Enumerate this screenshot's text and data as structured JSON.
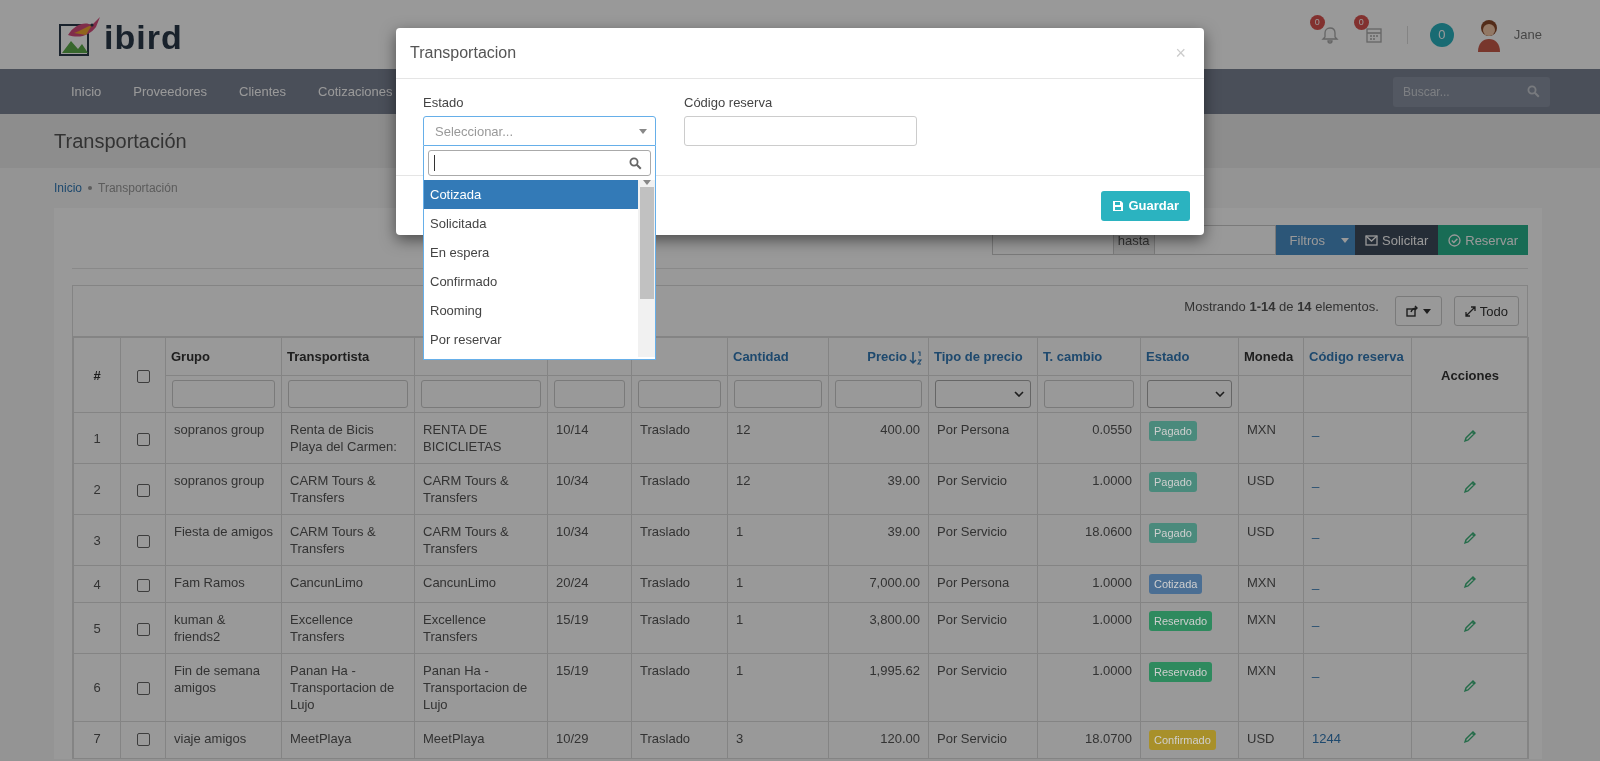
{
  "header": {
    "logo": "ibird",
    "notifications": [
      {
        "kind": "bell",
        "count": "0"
      },
      {
        "kind": "calendar",
        "count": "0"
      }
    ],
    "messages": "0",
    "user": "Jane"
  },
  "nav": {
    "items": [
      "Inicio",
      "Proveedores",
      "Clientes",
      "Cotizaciones"
    ],
    "search": {
      "placeholder": "Buscar..."
    }
  },
  "page_title": "Transportación",
  "breadcrumb": [
    "Inicio",
    "Transportación"
  ],
  "toolbar": {
    "range_separator": "hasta",
    "buttons": [
      {
        "kind": "filter",
        "label": "Filtros"
      },
      {
        "kind": "request",
        "label": "Solicitar"
      },
      {
        "kind": "reserve",
        "label": "Reservar"
      }
    ]
  },
  "table": {
    "summary": "Mostrando **1-14** de **14** elementos.",
    "expand_button": "Todo",
    "columns": [
      {
        "kind": "index",
        "label": "#"
      },
      {
        "kind": "checkbox",
        "checked": false
      },
      {
        "kind": "data",
        "label": "Grupo",
        "sortable": false,
        "filter": {
          "kind": "text"
        }
      },
      {
        "kind": "data",
        "label": "Transportista",
        "sortable": false,
        "filter": {
          "kind": "text"
        }
      },
      {
        "kind": "data",
        "filter": {
          "kind": "text"
        }
      },
      {
        "kind": "data",
        "filter": {
          "kind": "text"
        }
      },
      {
        "kind": "data",
        "filter": {
          "kind": "text"
        }
      },
      {
        "kind": "data",
        "label": "Cantidad",
        "sortable": true,
        "sorted": false,
        "filter": {
          "kind": "text"
        }
      },
      {
        "kind": "data",
        "label": "Precio",
        "sortable": true,
        "sorted": true,
        "filter": {
          "kind": "text"
        }
      },
      {
        "kind": "data",
        "label": "Tipo de precio",
        "sortable": true,
        "sorted": false,
        "filter": {
          "kind": "select"
        }
      },
      {
        "kind": "data",
        "label": "T. cambio",
        "sortable": true,
        "sorted": false,
        "filter": {
          "kind": "text"
        }
      },
      {
        "kind": "data",
        "label": "Estado",
        "sortable": true,
        "sorted": false,
        "filter": {
          "kind": "select"
        }
      },
      {
        "kind": "data",
        "label": "Moneda",
        "sortable": false
      },
      {
        "kind": "data",
        "label": "Código reserva",
        "sortable": true,
        "sorted": false
      },
      {
        "kind": "actions",
        "label": "Acciones"
      }
    ],
    "rows": [
      {
        "number": "1",
        "checked": false,
        "grupo": "sopranos group",
        "transportista": "Renta de Bicis Playa del Carmen:",
        "servicio": "RENTA DE BICICLIETAS",
        "column_6": "10/14",
        "tipo": "Traslado",
        "cantidad": "12",
        "precio": "400.00",
        "tipo_de_precio": "Por Persona",
        "t_cambio": "0.0550",
        "estado": {
          "label": "Pagado",
          "color": "#4a8a7c"
        },
        "moneda": "MXN",
        "codigo_reserva": "_"
      },
      {
        "number": "2",
        "checked": false,
        "grupo": "sopranos group",
        "transportista": "CARM Tours & Transfers",
        "servicio": "CARM Tours & Transfers",
        "column_6": "10/34",
        "tipo": "Traslado",
        "cantidad": "12",
        "precio": "39.00",
        "tipo_de_precio": "Por Servicio",
        "t_cambio": "1.0000",
        "estado": {
          "label": "Pagado",
          "color": "#4a8a7c"
        },
        "moneda": "USD",
        "codigo_reserva": "_"
      },
      {
        "number": "3",
        "checked": false,
        "grupo": "Fiesta de amigos",
        "transportista": "CARM Tours & Transfers",
        "servicio": "CARM Tours & Transfers",
        "column_6": "10/34",
        "tipo": "Traslado",
        "cantidad": "1",
        "precio": "39.00",
        "tipo_de_precio": "Por Servicio",
        "t_cambio": "18.0600",
        "estado": {
          "label": "Pagado",
          "color": "#4a8a7c"
        },
        "moneda": "USD",
        "codigo_reserva": "_"
      },
      {
        "number": "4",
        "checked": false,
        "grupo": "Fam Ramos",
        "transportista": "CancunLimo",
        "servicio": "CancunLimo",
        "column_6": "20/24",
        "tipo": "Traslado",
        "cantidad": "1",
        "precio": "7,000.00",
        "tipo_de_precio": "Por Persona",
        "t_cambio": "1.0000",
        "estado": {
          "label": "Cotizada",
          "color": "#4a6e93"
        },
        "moneda": "MXN",
        "codigo_reserva": "_"
      },
      {
        "number": "5",
        "checked": false,
        "grupo": "kuman & friends2",
        "transportista": "Excellence Transfers",
        "servicio": "Excellence Transfers",
        "column_6": "15/19",
        "tipo": "Traslado",
        "cantidad": "1",
        "precio": "3,800.00",
        "tipo_de_precio": "Por Servicio",
        "t_cambio": "1.0000",
        "estado": {
          "label": "Reservado",
          "color": "#2e8a5e"
        },
        "moneda": "MXN",
        "codigo_reserva": "_"
      },
      {
        "number": "6",
        "checked": false,
        "grupo": "Fin de semana amigos",
        "transportista": "Panan Ha - Transportacion de Lujo",
        "servicio": "Panan Ha - Transportacion de Lujo",
        "column_6": "15/19",
        "tipo": "Traslado",
        "cantidad": "1",
        "precio": "1,995.62",
        "tipo_de_precio": "Por Servicio",
        "t_cambio": "1.0000",
        "estado": {
          "label": "Reservado",
          "color": "#2e8a5e"
        },
        "moneda": "MXN",
        "codigo_reserva": "_"
      },
      {
        "number": "7",
        "checked": false,
        "grupo": "viaje amigos",
        "transportista": "MeetPlaya",
        "servicio": "MeetPlaya",
        "column_6": "10/29",
        "tipo": "Traslado",
        "cantidad": "3",
        "precio": "120.00",
        "tipo_de_precio": "Por Servicio",
        "t_cambio": "18.0700",
        "estado": {
          "label": "Confirmado",
          "color": "#a8902a"
        },
        "moneda": "USD",
        "codigo_reserva": "1244"
      }
    ]
  },
  "modal": {
    "title": "Transportacion",
    "close": "×",
    "fields": {
      "estado_label": "Estado",
      "estado_placeholder": "Seleccionar...",
      "codigo_label": "Código reserva"
    },
    "dropdown": {
      "options": [
        {
          "label": "Cotizada",
          "selected": true
        },
        {
          "label": "Solicitada",
          "selected": false
        },
        {
          "label": "En espera",
          "selected": false
        },
        {
          "label": "Confirmado",
          "selected": false
        },
        {
          "label": "Rooming",
          "selected": false
        },
        {
          "label": "Por reservar",
          "selected": false
        }
      ]
    },
    "save_button": "Guardar"
  }
}
